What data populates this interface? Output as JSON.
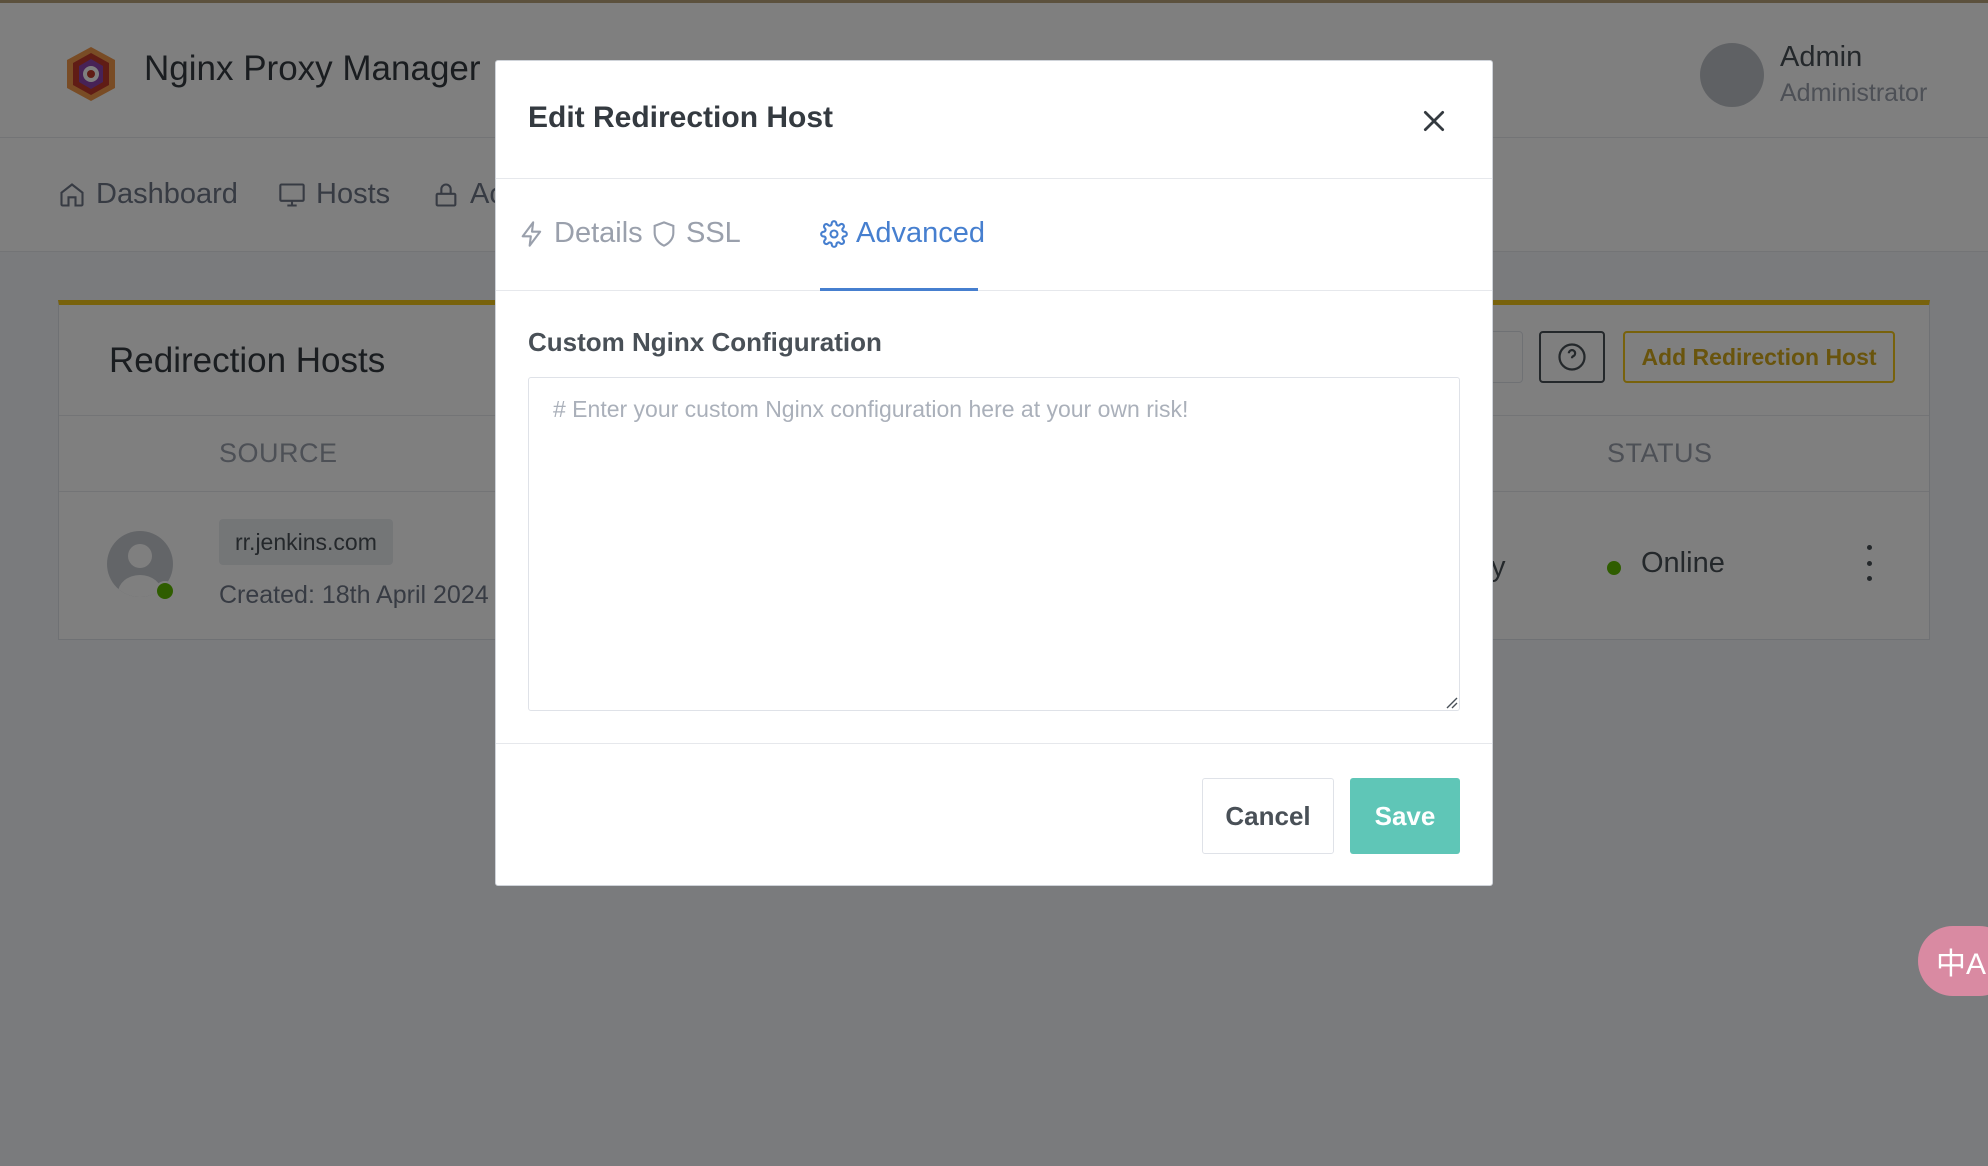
{
  "app": {
    "brand": "Nginx Proxy Manager",
    "user": {
      "name": "Admin",
      "role": "Administrator"
    }
  },
  "nav": {
    "items": [
      {
        "label": "Dashboard",
        "icon": "home-icon"
      },
      {
        "label": "Hosts",
        "icon": "monitor-icon"
      },
      {
        "label": "Ac",
        "icon": "lock-icon"
      }
    ]
  },
  "card": {
    "title": "Redirection Hosts",
    "add_button": "Add Redirection Host",
    "columns": {
      "source": "SOURCE",
      "status": "STATUS"
    },
    "rows": [
      {
        "domain": "rr.jenkins.com",
        "created": "Created: 18th April 2024",
        "partial": "y",
        "status": "Online"
      }
    ]
  },
  "modal": {
    "title": "Edit Redirection Host",
    "tabs": [
      {
        "label": "Details",
        "icon": "bolt-icon",
        "active": false
      },
      {
        "label": "SSL",
        "icon": "shield-icon",
        "active": false
      },
      {
        "label": "Advanced",
        "icon": "gear-icon",
        "active": true
      }
    ],
    "field_label": "Custom Nginx Configuration",
    "textarea": {
      "value": "",
      "placeholder": "# Enter your custom Nginx configuration here at your own risk!"
    },
    "cancel": "Cancel",
    "save": "Save"
  },
  "colors": {
    "accent": "#467fcf",
    "save": "#5fc6b7",
    "status_online": "#5eba00",
    "card_border": "#f0c419"
  },
  "translate_fab": {
    "glyph": "中A"
  }
}
